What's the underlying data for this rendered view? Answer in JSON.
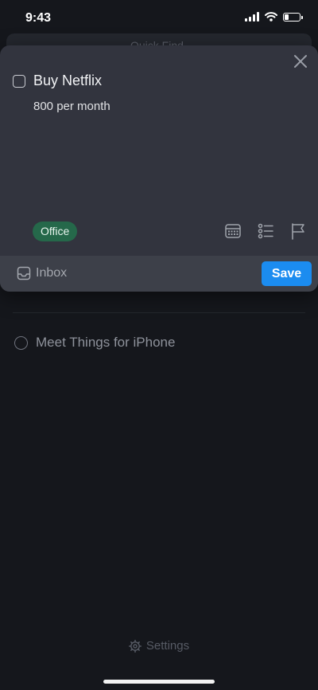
{
  "status_bar": {
    "time": "9:43"
  },
  "background": {
    "search_text": "Quick Find",
    "task": "Meet Things for iPhone",
    "settings_label": "Settings"
  },
  "editor": {
    "title": "Buy Netflix",
    "notes": "800 per month",
    "tag": "Office",
    "list_label": "Inbox",
    "save_label": "Save"
  },
  "colors": {
    "accent": "#1b8cf0",
    "tag_bg": "#25684a",
    "card_bg": "#32343e",
    "page_bg": "#15171c"
  }
}
